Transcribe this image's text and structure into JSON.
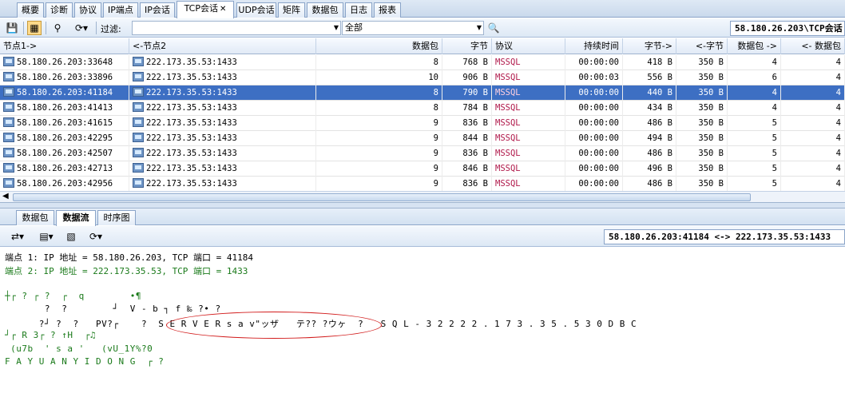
{
  "main_tabs": [
    {
      "label": "概要"
    },
    {
      "label": "诊断"
    },
    {
      "label": "协议"
    },
    {
      "label": "IP端点"
    },
    {
      "label": "IP会话"
    },
    {
      "label": "TCP会话",
      "active": true,
      "closable": true
    },
    {
      "label": "UDP会话"
    },
    {
      "label": "矩阵"
    },
    {
      "label": "数据包"
    },
    {
      "label": "日志"
    },
    {
      "label": "报表"
    }
  ],
  "toolbar": {
    "filter_label": "过滤:",
    "filter_value": "",
    "scope_value": "全部",
    "endpoint_path": "58.180.26.203\\TCP会话"
  },
  "table": {
    "headers": [
      "节点1->",
      "<-节点2",
      "数据包",
      "字节",
      "协议",
      "持续时间",
      "字节->",
      "<-字节",
      "数据包 ->",
      "<- 数据包"
    ],
    "rows": [
      {
        "n1": "58.180.26.203:33648",
        "n2": "222.173.35.53:1433",
        "pkts": "8",
        "bytes": "768  B",
        "proto": "MSSQL",
        "dur": "00:00:00",
        "b_out": "418  B",
        "b_in": "350  B",
        "p_out": "4",
        "p_in": "4"
      },
      {
        "n1": "58.180.26.203:33896",
        "n2": "222.173.35.53:1433",
        "pkts": "10",
        "bytes": "906  B",
        "proto": "MSSQL",
        "dur": "00:00:03",
        "b_out": "556  B",
        "b_in": "350  B",
        "p_out": "6",
        "p_in": "4"
      },
      {
        "n1": "58.180.26.203:41184",
        "n2": "222.173.35.53:1433",
        "pkts": "8",
        "bytes": "790  B",
        "proto": "MSSQL",
        "dur": "00:00:00",
        "b_out": "440  B",
        "b_in": "350  B",
        "p_out": "4",
        "p_in": "4",
        "selected": true
      },
      {
        "n1": "58.180.26.203:41413",
        "n2": "222.173.35.53:1433",
        "pkts": "8",
        "bytes": "784  B",
        "proto": "MSSQL",
        "dur": "00:00:00",
        "b_out": "434  B",
        "b_in": "350  B",
        "p_out": "4",
        "p_in": "4"
      },
      {
        "n1": "58.180.26.203:41615",
        "n2": "222.173.35.53:1433",
        "pkts": "9",
        "bytes": "836  B",
        "proto": "MSSQL",
        "dur": "00:00:00",
        "b_out": "486  B",
        "b_in": "350  B",
        "p_out": "5",
        "p_in": "4"
      },
      {
        "n1": "58.180.26.203:42295",
        "n2": "222.173.35.53:1433",
        "pkts": "9",
        "bytes": "844  B",
        "proto": "MSSQL",
        "dur": "00:00:00",
        "b_out": "494  B",
        "b_in": "350  B",
        "p_out": "5",
        "p_in": "4"
      },
      {
        "n1": "58.180.26.203:42507",
        "n2": "222.173.35.53:1433",
        "pkts": "9",
        "bytes": "836  B",
        "proto": "MSSQL",
        "dur": "00:00:00",
        "b_out": "486  B",
        "b_in": "350  B",
        "p_out": "5",
        "p_in": "4"
      },
      {
        "n1": "58.180.26.203:42713",
        "n2": "222.173.35.53:1433",
        "pkts": "9",
        "bytes": "846  B",
        "proto": "MSSQL",
        "dur": "00:00:00",
        "b_out": "496  B",
        "b_in": "350  B",
        "p_out": "5",
        "p_in": "4"
      },
      {
        "n1": "58.180.26.203:42956",
        "n2": "222.173.35.53:1433",
        "pkts": "9",
        "bytes": "836  B",
        "proto": "MSSQL",
        "dur": "00:00:00",
        "b_out": "486  B",
        "b_in": "350  B",
        "p_out": "5",
        "p_in": "4"
      }
    ]
  },
  "bottom_tabs": [
    {
      "label": "数据包"
    },
    {
      "label": "数据流",
      "active": true
    },
    {
      "label": "时序图"
    }
  ],
  "stream": {
    "conversation": "58.180.26.203:41184 <-> 222.173.35.53:1433",
    "endpoint1": "端点 1: IP 地址 = 58.180.26.203, TCP 端口 = 41184",
    "endpoint2": "端点 2: IP 地址 = 222.173.35.53, TCP 端口 = 1433",
    "payload_lines": [
      "┼┌ ? ┌ ?  ┌  q        •¶",
      "       ?  ?        ┘  V - b ┐ f ‰ ?• ?",
      "      ?┘ ?  ?   PV?┌    ?  S E R V E R s a v\"ッザ   テ?? ?ウヶ  ?   S Q L - 3 2 2 2 2 . 1 7 3 . 3 5 . 5 3 0 D B C",
      "┘┌ R 3┌ ? ↑H  ┌♫",
      " (u7b  ' s a '   (vU_1Y%?0",
      "F A Y U A N Y I D O N G  ┌ ?"
    ]
  },
  "colors": {
    "selected_row": "#3d6fc3",
    "protocol_text": "#b0184a",
    "endpoint2_text": "#1a7a1a",
    "annotation_circle": "#d21c1c"
  }
}
